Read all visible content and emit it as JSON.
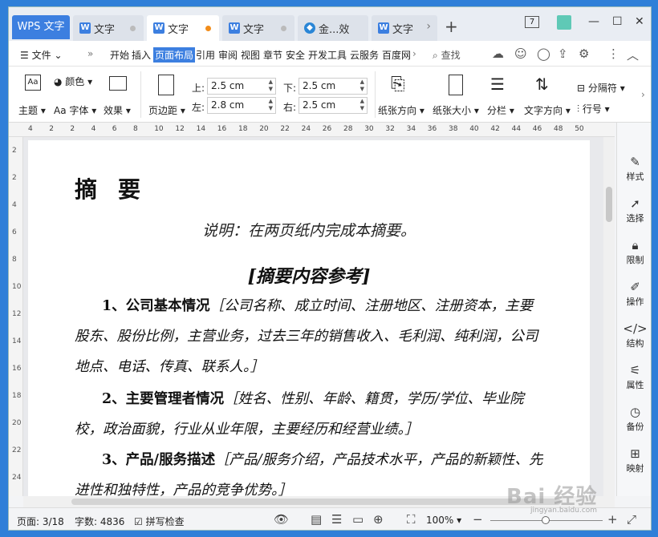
{
  "titlebar": {
    "app_tab": "WPS 文字",
    "tabs": [
      {
        "label": "文字",
        "dot": "gray"
      },
      {
        "label": "文字",
        "dot": "orange",
        "active": true
      },
      {
        "label": "文字",
        "dot": "gray"
      },
      {
        "label": "金...效",
        "icon": "cloud-icon"
      },
      {
        "label": "文字"
      }
    ],
    "window_badge": "7"
  },
  "menu": {
    "file": "文件",
    "items": [
      "开始",
      "插入",
      "页面布局",
      "引用",
      "审阅",
      "视图",
      "章节",
      "安全",
      "开发工具",
      "云服务",
      "百度网"
    ],
    "active": "页面布局",
    "search": "查找"
  },
  "ribbon": {
    "theme": "主题",
    "color": "颜色",
    "font": "字体",
    "effect": "效果",
    "margin": "页边距",
    "top_label": "上:",
    "top_value": "2.5 cm",
    "bottom_label": "下:",
    "bottom_value": "2.5 cm",
    "left_label": "左:",
    "left_value": "2.8 cm",
    "right_label": "右:",
    "right_value": "2.5 cm",
    "orientation": "纸张方向",
    "size": "纸张大小",
    "columns": "分栏",
    "text_direction": "文字方向",
    "separator": "分隔符",
    "line_number": "行号"
  },
  "ruler": {
    "ticks": [
      "4",
      "2",
      "2",
      "4",
      "6",
      "8",
      "10",
      "12",
      "14",
      "16",
      "18",
      "20",
      "22",
      "24",
      "26",
      "28",
      "30",
      "32",
      "34",
      "36",
      "38",
      "40",
      "42",
      "44",
      "46",
      "48",
      "50"
    ],
    "vticks": [
      "2",
      "2",
      "4",
      "6",
      "8",
      "10",
      "12",
      "14",
      "16",
      "18",
      "20",
      "22",
      "24"
    ]
  },
  "document": {
    "heading": "摘要",
    "note": "说明：在两页纸内完成本摘要。",
    "section_title": "[摘要内容参考]",
    "paragraphs": [
      {
        "bold": "1、公司基本情况",
        "italic": "［公司名称、成立时间、注册地区、注册资本，主要股东、股份比例，主营业务，过去三年的销售收入、毛利润、纯利润，公司地点、电话、传真、联系人。］"
      },
      {
        "bold": "2、主要管理者情况",
        "italic": "［姓名、性别、年龄、籍贯，学历/学位、毕业院校，政治面貌，行业从业年限，主要经历和经营业绩。］"
      },
      {
        "bold": "3、产品/服务描述",
        "italic": "［产品/服务介绍，产品技术水平，产品的新颖性、先进性和独特性，产品的竞争优势。］"
      }
    ]
  },
  "sidepanel": [
    "样式",
    "选择",
    "限制",
    "操作",
    "结构",
    "属性",
    "备份",
    "映射"
  ],
  "status": {
    "page": "页面: 3/18",
    "words": "字数: 4836",
    "spell": "拼写检查",
    "zoom": "100%"
  },
  "watermark": "Bai 经验",
  "watermark_url": "jingyan.baidu.com"
}
